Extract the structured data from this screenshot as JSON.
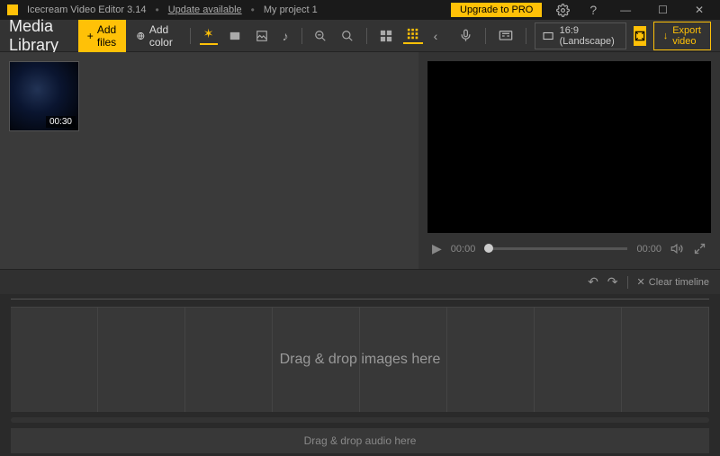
{
  "titlebar": {
    "app_name": "Icecream Video Editor 3.14",
    "update_link": "Update available",
    "project_name": "My project 1",
    "upgrade_label": "Upgrade to PRO"
  },
  "toolbar": {
    "media_library_title": "Media Library",
    "add_files_label": "Add files",
    "add_color_label": "Add color",
    "aspect_label": "16:9 (Landscape)",
    "export_label": "Export video"
  },
  "library": {
    "items": [
      {
        "duration": "00:30"
      }
    ]
  },
  "preview": {
    "current_time": "00:00",
    "total_time": "00:00"
  },
  "timeline": {
    "clear_label": "Clear timeline",
    "video_drop_hint": "Drag & drop images here",
    "audio_drop_hint": "Drag & drop audio here"
  }
}
